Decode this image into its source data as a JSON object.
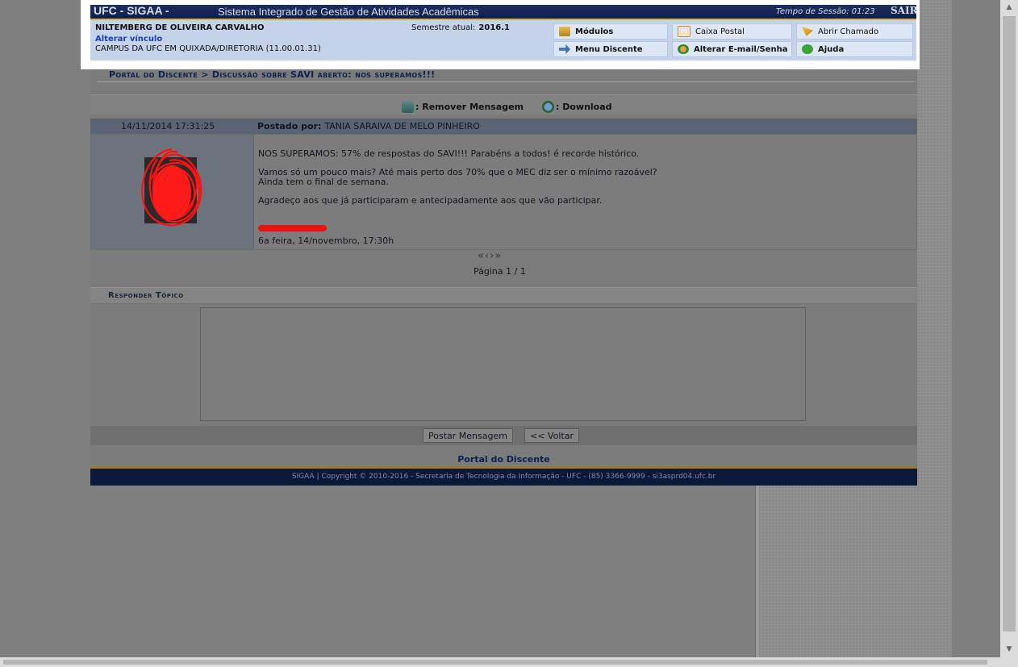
{
  "header": {
    "logo": "UFC - SIGAA -",
    "system_name": "Sistema Integrado de Gestão de Atividades Acadêmicas",
    "session_label": "Tempo de Sessão: 01:23",
    "logout": "SAIR",
    "user_name": "NILTEMBERG DE OLIVEIRA CARVALHO",
    "change_link": "Alterar vínculo",
    "campus": "CAMPUS DA UFC EM QUIXADA/DIRETORIA (11.00.01.31)",
    "semester_label": "Semestre atual:",
    "semester_value": "2016.1",
    "menu": {
      "modulos": "Módulos",
      "caixa_postal": "Caixa Postal",
      "abrir_chamado": "Abrir Chamado",
      "menu_discente": "Menu Discente",
      "alterar_email": "Alterar E-mail/Senha",
      "ajuda": "Ajuda"
    }
  },
  "breadcrumb": "Portal do Discente > Discussão sobre SAVI aberto: nos superamos!!!",
  "legend": {
    "remove": ": Remover Mensagem",
    "download": ": Download"
  },
  "post": {
    "date": "14/11/2014 17:31:25",
    "author_label": "Postado por:",
    "author": "TANIA SARAIVA DE MELO PINHEIRO",
    "lines": [
      "NOS SUPERAMOS: 57% de respostas do SAVI!!! Parabéns a todos! é recorde histórico.",
      "Vamos só um pouco mais? Até mais perto dos 70% que o MEC diz ser o mínimo razoável?",
      "Ainda tem o final de semana.",
      "Agradeço aos que já participaram e antecipadamente aos que vão participar."
    ],
    "signature_date": "6a feira, 14/novembro, 17:30h"
  },
  "pagination": {
    "label": "Página 1 / 1"
  },
  "reply": {
    "title": "Responder Tópico",
    "text": "",
    "post_button": "Postar Mensagem",
    "back_button": "<< Voltar"
  },
  "footer": {
    "title": "Portal do Discente",
    "copyright": "SIGAA | Copyright © 2010-2016 - Secretaria de Tecnologia da Informação - UFC - (85) 3366-9999 - si3asprd04.ufc.br"
  }
}
